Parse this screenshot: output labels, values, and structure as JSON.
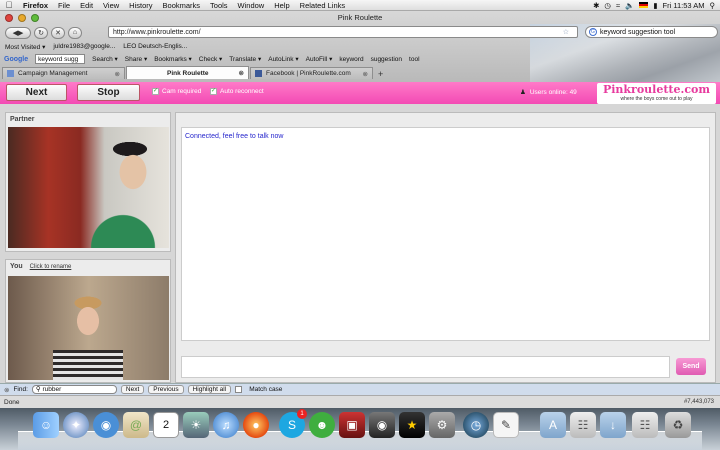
{
  "menubar": {
    "app": "Firefox",
    "items": [
      "File",
      "Edit",
      "View",
      "History",
      "Bookmarks",
      "Tools",
      "Window",
      "Help",
      "Related Links"
    ],
    "clock": "Fri 11:53 AM"
  },
  "window": {
    "title": "Pink Roulette"
  },
  "navbar": {
    "url": "http://www.pinkroulette.com/",
    "search_value": "keyword suggestion tool"
  },
  "bookmarks": [
    "Most Visited ▾",
    "juldre1983@google...",
    "LEO Deutsch-Englis..."
  ],
  "google_toolbar": {
    "logo": "Google",
    "search_value": "keyword sugg",
    "items": [
      "Search ▾",
      "Share ▾",
      "Bookmarks ▾",
      "Check ▾",
      "Translate ▾",
      "AutoLink ▾",
      "AutoFill ▾",
      "keyword",
      "suggestion",
      "tool"
    ]
  },
  "tabs": [
    {
      "label": "Campaign Management"
    },
    {
      "label": "Pink Roulette"
    },
    {
      "label": "Facebook | PinkRoulette.com"
    }
  ],
  "header": {
    "next_label": "Next",
    "stop_label": "Stop",
    "cam_required": "Cam required",
    "auto_reconnect": "Auto reconnect",
    "users_online": "Users online: 49",
    "logo": "Pinkroulette.com",
    "tagline": "where the boys come out to play"
  },
  "partner": {
    "title": "Partner"
  },
  "you": {
    "title": "You",
    "rename_link": "Click to rename"
  },
  "chat": {
    "message": "Connected, feel free to talk now",
    "send_label": "Send"
  },
  "findbar": {
    "label": "Find:",
    "value": "rubber",
    "next": "Next",
    "previous": "Previous",
    "highlight": "Highlight all",
    "match_case": "Match case"
  },
  "status": {
    "text": "Done",
    "rank": "#7,443,073"
  }
}
